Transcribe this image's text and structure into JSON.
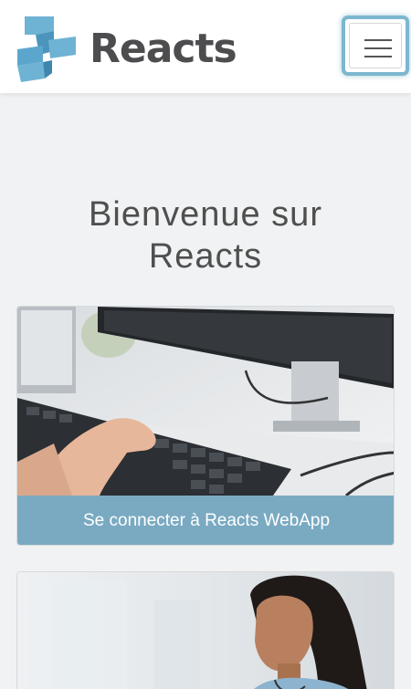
{
  "header": {
    "logo_text": "Reacts",
    "menu_icon": "hamburger-menu-icon"
  },
  "welcome": {
    "line1": "Bienvenue sur",
    "line2": "Reacts"
  },
  "cards": [
    {
      "button_label": "Se connecter à Reacts WebApp",
      "image": "keyboard-computer-photo"
    },
    {
      "image": "doctor-photo"
    }
  ],
  "colors": {
    "brand_blue": "#5ba0c4",
    "button_bg": "#7aaac2",
    "text_dark": "#4d4d4f"
  }
}
